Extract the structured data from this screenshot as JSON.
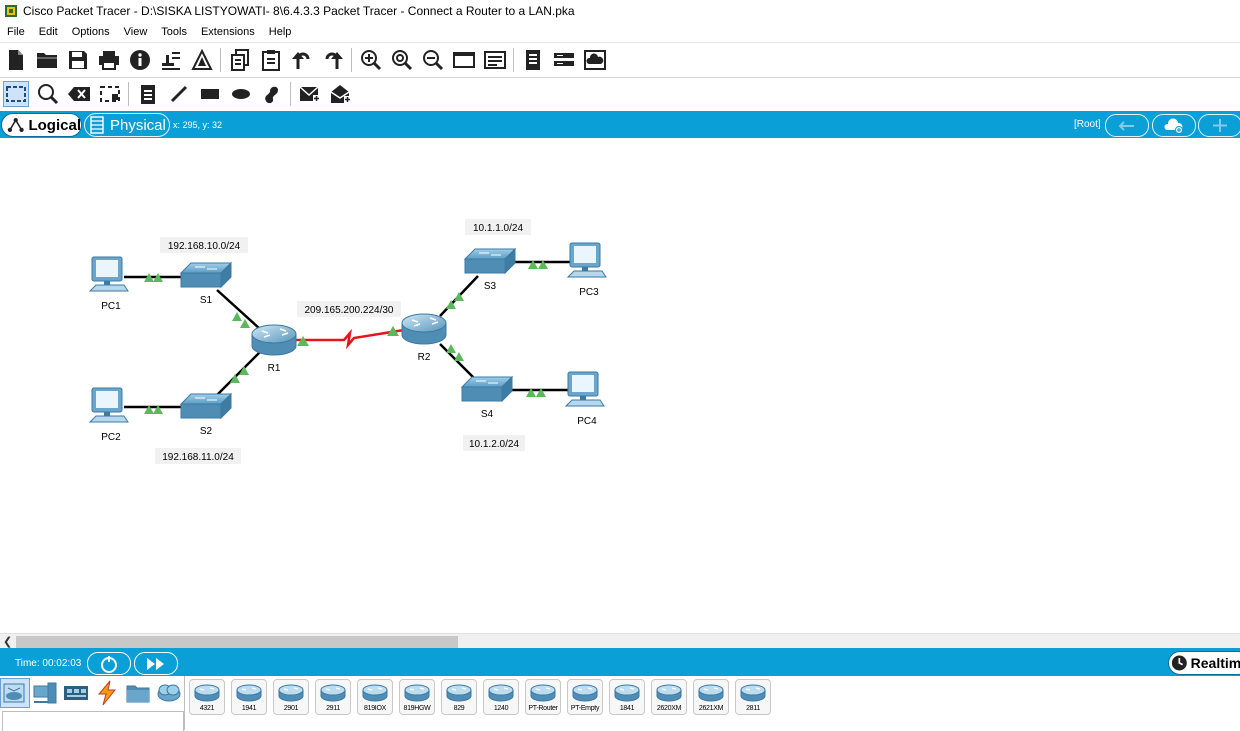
{
  "window": {
    "title": "Cisco Packet Tracer - D:\\SISKA LISTYOWATI- 8\\6.4.3.3 Packet Tracer - Connect a Router to a LAN.pka"
  },
  "menu": [
    "File",
    "Edit",
    "Options",
    "View",
    "Tools",
    "Extensions",
    "Help"
  ],
  "toolbar_main": [
    {
      "icon": "new-file-icon"
    },
    {
      "icon": "open-folder-icon"
    },
    {
      "icon": "save-icon"
    },
    {
      "icon": "print-icon"
    },
    {
      "icon": "info-icon"
    },
    {
      "icon": "activity-wizard-icon"
    },
    {
      "icon": "custom-device-icon"
    },
    {
      "icon": "copy-icon"
    },
    {
      "icon": "paste-icon"
    },
    {
      "icon": "undo-icon"
    },
    {
      "icon": "redo-icon"
    },
    {
      "icon": "zoom-in-icon"
    },
    {
      "icon": "zoom-reset-icon"
    },
    {
      "icon": "zoom-out-icon"
    },
    {
      "icon": "drawing-palette-icon"
    },
    {
      "icon": "custom-devices-dialog-icon"
    },
    {
      "icon": "viewport-icon"
    },
    {
      "icon": "network-device-icon"
    },
    {
      "icon": "cloud-icon"
    }
  ],
  "toolbar_edit": [
    {
      "icon": "select-icon",
      "active": true
    },
    {
      "icon": "inspect-icon"
    },
    {
      "icon": "delete-icon"
    },
    {
      "icon": "resize-shape-icon"
    },
    {
      "icon": "place-note-icon"
    },
    {
      "icon": "draw-line-icon"
    },
    {
      "icon": "draw-rectangle-icon"
    },
    {
      "icon": "draw-ellipse-icon"
    },
    {
      "icon": "freeform-icon"
    },
    {
      "icon": "add-simple-pdu-icon"
    },
    {
      "icon": "add-complex-pdu-icon"
    }
  ],
  "viewbar": {
    "logical": "Logical",
    "physical": "Physical",
    "coords": "x: 295, y: 32",
    "root": "[Root]"
  },
  "topology": {
    "labels": {
      "net_s1": "192.168.10.0/24",
      "net_s2": "192.168.11.0/24",
      "net_wan": "209.165.200.224/30",
      "net_s3": "10.1.1.0/24",
      "net_s4": "10.1.2.0/24"
    },
    "devices": {
      "pc1": "PC1",
      "pc2": "PC2",
      "pc3": "PC3",
      "pc4": "PC4",
      "s1": "S1",
      "s2": "S2",
      "s3": "S3",
      "s4": "S4",
      "r1": "R1",
      "r2": "R2"
    }
  },
  "colors": {
    "accent": "#0b9fd8",
    "link_up": "#5cb85c",
    "serial_link": "#e8141b",
    "device_blue": "#5b9cc4"
  },
  "simulation": {
    "time": "Time: 00:02:03",
    "realtime": "Realtime"
  },
  "device_categories": [
    {
      "icon": "network-devices-icon",
      "active": true
    },
    {
      "icon": "end-devices-icon"
    },
    {
      "icon": "components-icon"
    },
    {
      "icon": "connections-icon"
    },
    {
      "icon": "miscellaneous-icon"
    },
    {
      "icon": "multiuser-icon"
    }
  ],
  "device_models": [
    "4321",
    "1941",
    "2901",
    "2911",
    "819IOX",
    "819HGW",
    "829",
    "1240",
    "PT-Router",
    "PT-Empty",
    "1841",
    "2620XM",
    "2621XM",
    "2811"
  ]
}
